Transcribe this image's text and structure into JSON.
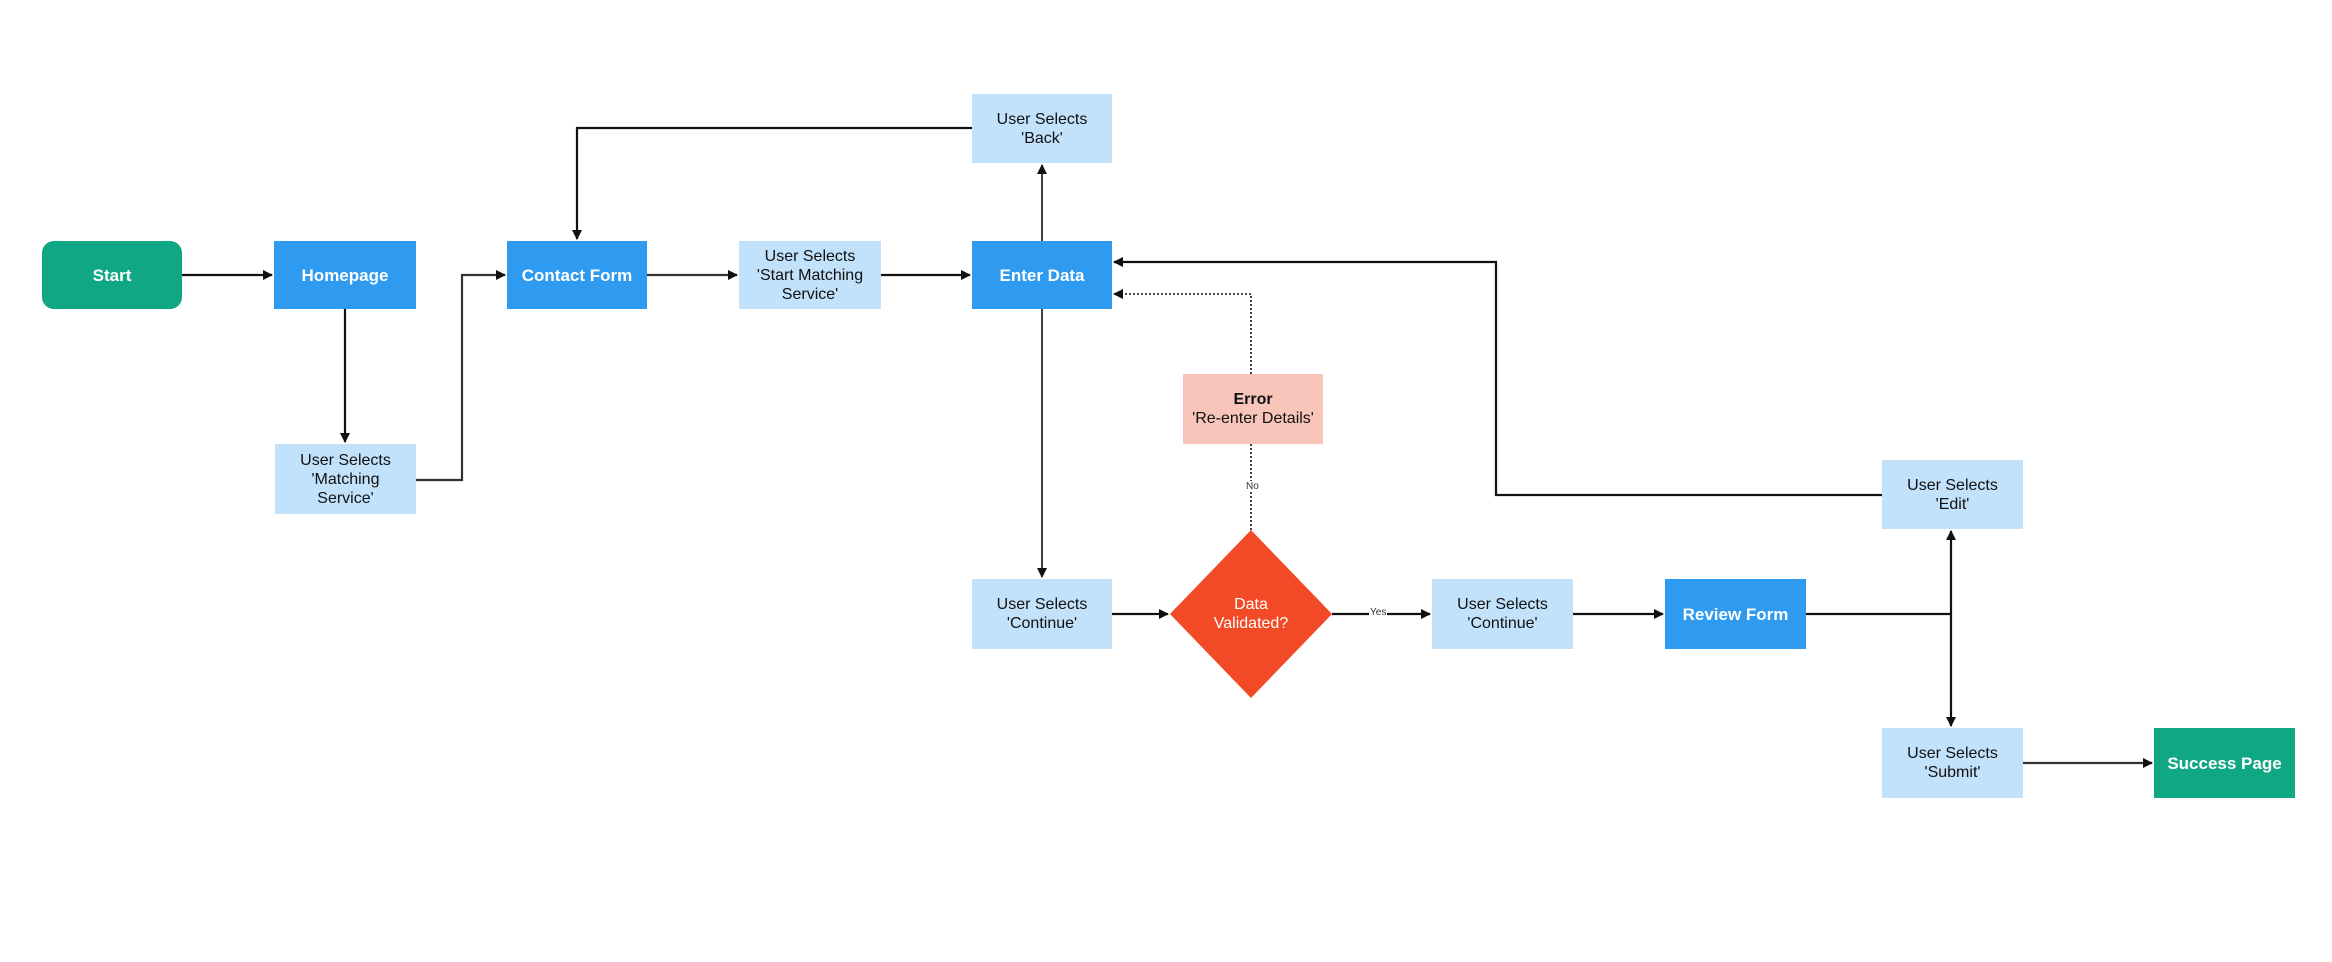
{
  "nodes": {
    "start": "Start",
    "homepage": "Homepage",
    "matching_service": "User Selects\n'Matching\nService'",
    "contact_form": "Contact Form",
    "start_matching": "User Selects\n'Start Matching\nService'",
    "enter_data": "Enter Data",
    "back": "User Selects\n'Back'",
    "continue_1": "User Selects\n'Continue'",
    "decision": "Data\nValidated?",
    "error_title": "Error",
    "error_text": "'Re-enter Details'",
    "continue_2": "User Selects\n'Continue'",
    "review_form": "Review Form",
    "edit": "User Selects\n'Edit'",
    "submit": "User Selects\n'Submit'",
    "success": "Success Page"
  },
  "edge_labels": {
    "yes": "Yes",
    "no": "No"
  },
  "colors": {
    "primary": "#2e9af0",
    "action": "#c2e1fa",
    "terminal": "#0fa784",
    "decision": "#f24a27",
    "error": "#f9c5bb"
  }
}
